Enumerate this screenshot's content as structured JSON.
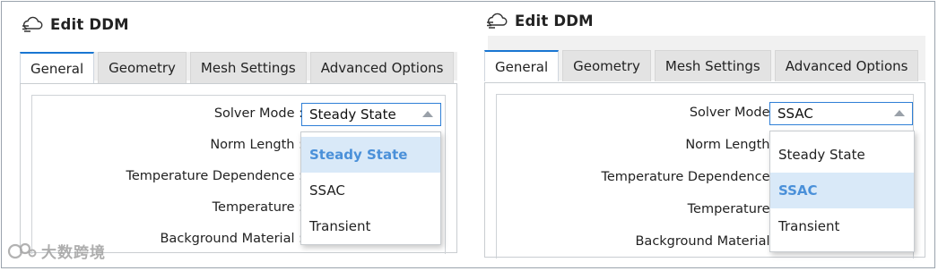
{
  "panels": [
    {
      "title": "Edit DDM",
      "tabs": [
        "General",
        "Geometry",
        "Mesh Settings",
        "Advanced Options"
      ],
      "active_tab": "General",
      "fields": [
        {
          "label": "Solver Mode :"
        },
        {
          "label": "Norm Length :"
        },
        {
          "label": "Temperature Dependence :"
        },
        {
          "label": "Temperature :"
        },
        {
          "label": "Background Material :"
        }
      ],
      "solver_mode_value": "Steady State",
      "dropdown_options": [
        "Steady State",
        "SSAC",
        "Transient"
      ],
      "selected_option": "Steady State"
    },
    {
      "title": "Edit DDM",
      "tabs": [
        "General",
        "Geometry",
        "Mesh Settings",
        "Advanced Options"
      ],
      "active_tab": "General",
      "fields": [
        {
          "label": "Solver Mode :"
        },
        {
          "label": "Norm Length :"
        },
        {
          "label": "Temperature Dependence :"
        },
        {
          "label": "Temperature :"
        },
        {
          "label": "Background Material :"
        }
      ],
      "solver_mode_value": "SSAC",
      "dropdown_options": [
        "Steady State",
        "SSAC",
        "Transient"
      ],
      "selected_option": "SSAC"
    }
  ],
  "watermark": "大数跨境",
  "icons": {
    "title_icon": "cloud-edit-icon",
    "combo_arrow": "triangle-up-icon",
    "watermark_logo": "logo-icon"
  },
  "colors": {
    "accent": "#1976d2",
    "selected_bg": "#d9e9f8",
    "selected_text": "#4a90d9"
  }
}
